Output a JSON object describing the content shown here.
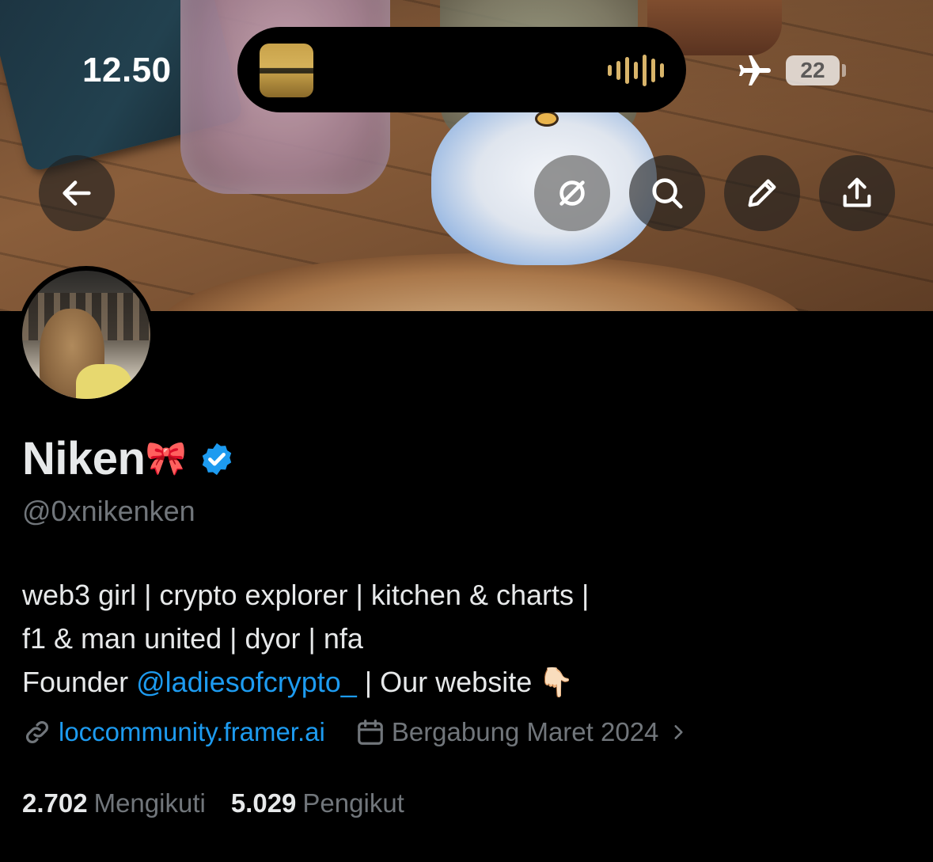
{
  "status_bar": {
    "time": "12.50",
    "battery": "22",
    "icons": [
      "airplane-mode-icon",
      "battery-icon",
      "now-playing-waveform-icon"
    ]
  },
  "header": {
    "buttons": [
      {
        "name": "back-button",
        "icon": "arrow-left-icon"
      },
      {
        "name": "grok-button",
        "icon": "grok-icon"
      },
      {
        "name": "search-button",
        "icon": "search-icon"
      },
      {
        "name": "edit-button",
        "icon": "pencil-icon"
      },
      {
        "name": "share-button",
        "icon": "share-icon"
      }
    ]
  },
  "profile": {
    "display_name": "Niken",
    "name_emoji": "🎀",
    "verified": true,
    "handle": "@0xnikenken",
    "bio": {
      "line1": "web3 girl | crypto explorer | kitchen & charts |",
      "line2": "f1 & man united | dyor | nfa",
      "line3_prefix": "Founder ",
      "line3_mention": "@ladiesofcrypto_",
      "line3_suffix": " | Our website",
      "line3_emoji": "👇🏻"
    },
    "website": "loccommunity.framer.ai",
    "joined": "Bergabung Maret 2024",
    "following_count": "2.702",
    "following_label": "Mengikuti",
    "followers_count": "5.029",
    "followers_label": "Pengikut"
  },
  "colors": {
    "background": "#000000",
    "text_primary": "#e7e9ea",
    "text_secondary": "#71767b",
    "accent_blue": "#1d9bf0"
  }
}
